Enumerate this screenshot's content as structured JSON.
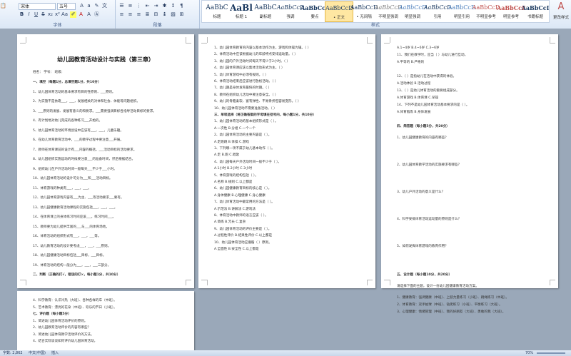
{
  "ribbon": {
    "font_name": "宋体",
    "font_size": "五号",
    "group_font": "字体",
    "group_paragraph": "段落",
    "group_styles": "样式",
    "styles": [
      {
        "preview": "AaBbC",
        "name": "标题"
      },
      {
        "preview": "AaBl",
        "name": "标题 1"
      },
      {
        "preview": "AaBbC",
        "name": "副标题"
      },
      {
        "preview": "AaBbCcD",
        "name": "强调"
      },
      {
        "preview": "AaBbCcD",
        "name": "要点"
      },
      {
        "preview": "AaBbCcD",
        "name": "• 正文"
      },
      {
        "preview": "AaBbCcD",
        "name": "• 无间隔"
      },
      {
        "preview": "AaBbCcD",
        "name": "不明显强调"
      },
      {
        "preview": "AaBbCcD",
        "name": "明显强调"
      },
      {
        "preview": "AaBbCcD",
        "name": "引用"
      },
      {
        "preview": "AaBbCcD",
        "name": "明显引用"
      },
      {
        "preview": "AaBbCcD",
        "name": "不明显参考"
      },
      {
        "preview": "AaBbCcD",
        "name": "明显参考"
      },
      {
        "preview": "AaBbCcI",
        "name": "书籍标题"
      }
    ],
    "change_styles": "更改样式",
    "colors": {
      "accent": "#17365d",
      "selected": "#ffe7a2"
    }
  },
  "doc": {
    "title": "幼儿园教育活动设计与实践（第三章）",
    "meta": "姓名：              学号：              班级：",
    "p1": [
      "一、填空（每题1分，总填空题1分，共10分）",
      "1、幼儿园体育活动的基本要求有目的性原则、___原则。",
      "2、为实施不是依靠___，___，发展相关的对体和社会、体能等问题组织。",
      "3、___原则的发展、发展有意义的和要求。___需要强调目标各指导活动目标的要求。",
      "4、有计划地对幼儿完成的各种练习___开始的。",
      "5、幼儿园体育活动的环境创设中应该有___，___，儿童乐趣。",
      "6、在幼儿体育教育活动中，___的教学过程中要注意___开展。",
      "7、教师在体育课前的设计有___内容的概括，___活动目标的活动要求。",
      "8、幼儿园组织实施运动的时候要注意___的准备时间，然后根据结合。",
      "9、组织幼儿在户外活动时间一般每天___不少于___小时。",
      "10、幼儿园体育活动的设计可分为___和___活动目标。",
      "11、体育游戏的种类有___，___，___。",
      "12、幼儿园体育游戏内容有___为主、___等活动要求___要有。",
      "13、幼儿园健康教育活动课程的实施包括___，___，___。",
      "14、在体育课上的身体练习时间应该___，练习时间___。",
      "15、教师要为幼儿提供丰富的___与___的体育场地。",
      "16、体育活动的组织形式有___，___，___等。",
      "17、幼儿教育活动的设计要考虑___，___，___原则。",
      "18、幼儿园健康活动目标包括___目标，___目标。",
      "19、体育活动的结构一般分为___，___，___三部分。",
      "二、判断（正确的打√，错误的打×，每小题1分，共10分）"
    ],
    "p2": [
      "1、幼儿园体育教育的内容以基本动作为主，游戏和体操为辅。（ ）",
      "2、体育活动中应该根据幼儿的年龄特点安排运动量。（ ）",
      "3、幼儿园的户外活动时间每天不得少于2小时。（ ）",
      "4、幼儿园体育课应该以集体活动形式为主。（ ）",
      "5、幼儿体育游戏中必须有规则。（ ）",
      "6、体育活动结束后应该进行放松活动。（ ）",
      "7、幼儿期是身体发育最快的时期。（ ）",
      "8、教师在组织幼儿活动中要注意安全。（ ）",
      "9、幼儿的骨骼柔软、富有弹性、不易骨折但容易变形。（ ）",
      "10、幼儿园体育活动不需要准备活动。（ ）",
      "三、单项选择（将正确答案的字母填在括号内，每小题1分，共10分）",
      "1、幼儿园体育活动的基本组织形式是（ ）。",
      "A.一次性    B.分组    C.一个一个",
      "2、幼儿园体育活动的主要内容是（ ）。",
      "A.走跑跳    B.体操    C.游戏",
      "3、下列哪一项不属于幼儿基本动作（ ）。",
      "A.走    B.跑    C.唱歌",
      "4、幼儿园每天户外活动时间一般不少于（ ）。",
      "A.1小时    B.2小时    C.3小时",
      "5、体育游戏的结构包括（ ）。",
      "A.名称    B.规则    C.以上都是",
      "6、幼儿园健康教育目标的核心是（ ）。",
      "A.身体健康    B.心理健康    C.身心健康",
      "7、幼儿体育活动中最常用的方法是（ ）。",
      "A.示范法    B.讲解法    C.游戏法",
      "8、体育活动中教师的语言应该（ ）。",
      "A.简练    B.冗长    C.复杂",
      "9、幼儿园体育活动的评价主要是（ ）。",
      "A.过程性评价    B.结果性评价    C.以上都是",
      "10、幼儿园体育活动应遵循（ ）原则。",
      "A.全面性    B.安全性    C.以上都是"
    ],
    "p3": [
      "A.1~4岁    B.4~6岁    C.3~6岁",
      "11、我们在教学时，应当（ ）与幼儿进行互动。",
      "A.平等的    B.严格的",
      "12、（ ）是指幼儿在活动中获得的体验。",
      "A.活动体验    B.活动过程",
      "13、（ ）是幼儿体育活动的重要组成部分。",
      "A.体育游戏    B.体育课    C.早操",
      "14、下列不是幼儿园体育活动基本要求的是（ ）。",
      "A.体育锻炼    B.身体发展",
      "四、简答题（每小题5分，共20分）",
      "1、幼儿园健康教育的内容有哪些？",
      "2、幼儿园体育教学活动的实施要求有哪些？",
      "3、幼儿户外活动的意义是什么？",
      "4、科学安排体育活动运动量的原则是什么？",
      "5、如何发挥体育游戏的教育作用？",
      "五、设计题（每小题10分，共20分）",
      "请选择下面的主题，设计一份幼儿园健康教育活动方案。",
      "1、健康教育：强调健康（中班）、上肢力量练习（小班）、跳绳练习（中班）。",
      "2、体育教育：双手拍球（中班）、钻爬练习（小班）、平衡练习（大班）。",
      "3、心理健康：情绪管理（中班）、我的好朋友（大班）、勇敢的我（大班）。"
    ],
    "p4": [
      "4、科学教育：认识冷热（大班）、各种各样的车（中班）。",
      "5、艺术教育：漂亮的花朵（中班）、欢乐的节日（小班）。",
      "七、评价题（每小题5分）",
      "1、简述幼儿园体育活动评价的原则。",
      "2、幼儿园教育活动评价的内容有哪些？",
      "3、简述幼儿园体育教学活动评价的方法。",
      "4、结合实际谈谈如何评价幼儿园体育活动。"
    ]
  },
  "status": {
    "words": "字数: 2,862",
    "lang": "中文(中国)",
    "mode": "插入",
    "zoom": "70%"
  }
}
